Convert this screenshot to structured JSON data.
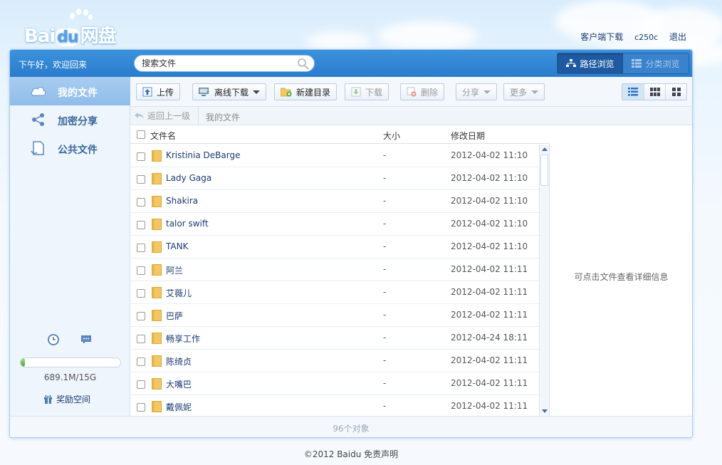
{
  "brand": {
    "logo_text_pre": "Bai",
    "logo_text_du": "du",
    "logo_text_post": "网盘"
  },
  "toplinks": {
    "client_download": "客户端下载",
    "user_id": "c250c",
    "logout": "退出"
  },
  "header": {
    "greeting": "下午好，欢迎回来",
    "search_placeholder": "搜索文件",
    "view_path": "路径浏览",
    "view_category": "分类浏览"
  },
  "sidebar": {
    "items": [
      {
        "label": "我的文件",
        "icon": "cloud-icon",
        "active": true
      },
      {
        "label": "加密分享",
        "icon": "share-icon",
        "active": false
      },
      {
        "label": "公共文件",
        "icon": "document-icon",
        "active": false
      }
    ],
    "quota_text": "689.1M/15G",
    "quota_fraction": 0.045,
    "reward_label": "奖励空间"
  },
  "toolbar": {
    "upload": "上传",
    "offline_download": "离线下载",
    "new_folder": "新建目录",
    "download": "下载",
    "delete": "删除",
    "share": "分享",
    "more": "更多"
  },
  "breadcrumb": {
    "back": "返回上一级",
    "current": "我的文件"
  },
  "table": {
    "headers": {
      "name": "文件名",
      "size": "大小",
      "modified": "修改日期"
    },
    "rows": [
      {
        "name": "Kristinia DeBarge",
        "size": "-",
        "date": "2012-04-02 11:10"
      },
      {
        "name": "Lady Gaga",
        "size": "-",
        "date": "2012-04-02 11:10"
      },
      {
        "name": "Shakira",
        "size": "-",
        "date": "2012-04-02 11:10"
      },
      {
        "name": "talor swift",
        "size": "-",
        "date": "2012-04-02 11:10"
      },
      {
        "name": "TANK",
        "size": "-",
        "date": "2012-04-02 11:10"
      },
      {
        "name": "阿兰",
        "size": "-",
        "date": "2012-04-02 11:11"
      },
      {
        "name": "艾薇儿",
        "size": "-",
        "date": "2012-04-02 11:11"
      },
      {
        "name": "巴萨",
        "size": "-",
        "date": "2012-04-02 11:11"
      },
      {
        "name": "畅享工作",
        "size": "-",
        "date": "2012-04-24 18:11"
      },
      {
        "name": "陈绮贞",
        "size": "-",
        "date": "2012-04-02 11:11"
      },
      {
        "name": "大嘴巴",
        "size": "-",
        "date": "2012-04-02 11:11"
      },
      {
        "name": "戴佩妮",
        "size": "-",
        "date": "2012-04-02 11:11"
      }
    ]
  },
  "detail": {
    "hint": "可点击文件查看详细信息"
  },
  "footer": {
    "count": "96个对象",
    "copyright": "©2012 Baidu 免责声明"
  },
  "colors": {
    "header_blue": "#2f84d2",
    "link": "#1a3a73",
    "folder": "#f3c764"
  }
}
